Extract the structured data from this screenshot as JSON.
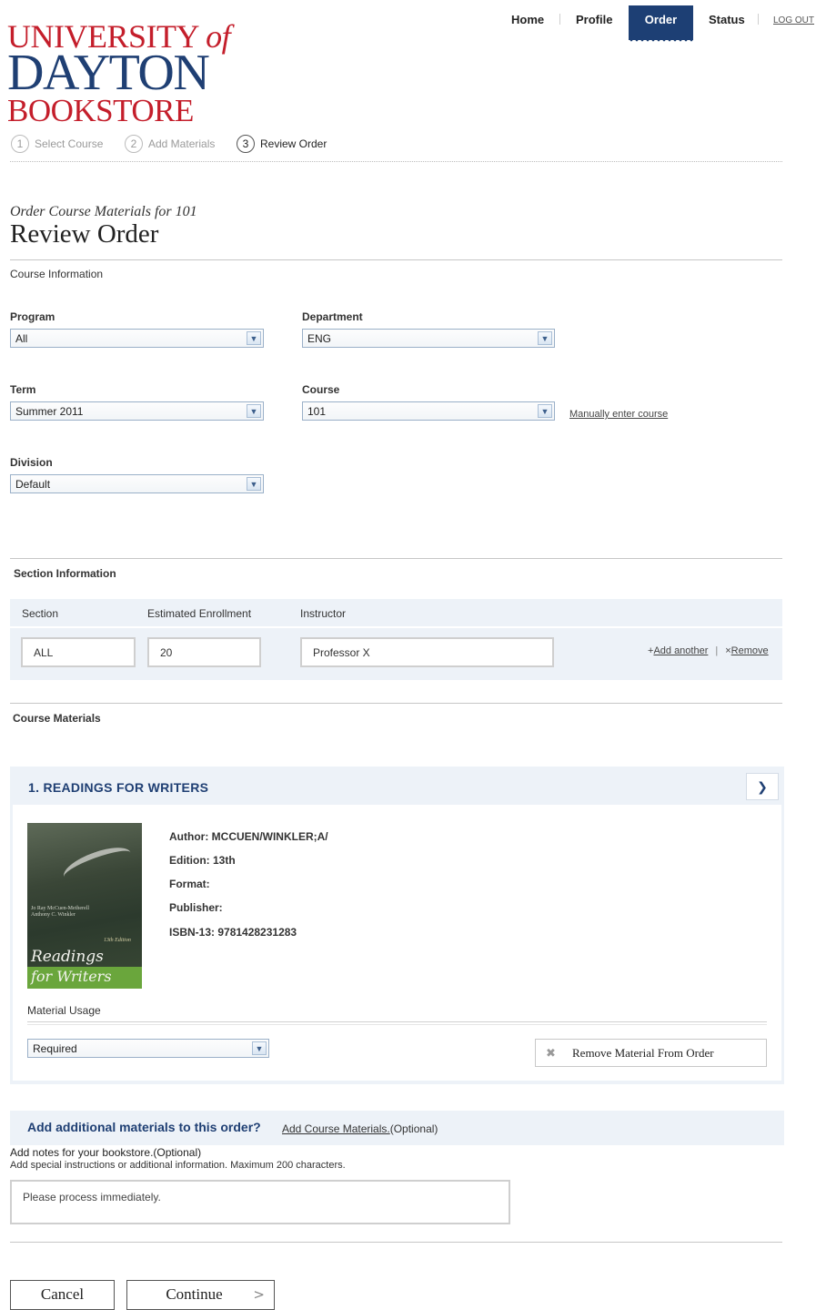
{
  "logo": {
    "line1_main": "UNIVERSITY",
    "line1_of": "of",
    "line2": "DAYTON",
    "line3": "BOOKSTORE"
  },
  "nav": {
    "home": "Home",
    "profile": "Profile",
    "order": "Order",
    "status": "Status",
    "logout": "LOG OUT"
  },
  "steps": [
    {
      "num": "1",
      "label": "Select Course"
    },
    {
      "num": "2",
      "label": "Add Materials"
    },
    {
      "num": "3",
      "label": "Review Order"
    }
  ],
  "page": {
    "subtitle": "Order Course Materials for 101",
    "title": "Review Order"
  },
  "course_info": {
    "heading": "Course Information",
    "program": {
      "label": "Program",
      "value": "All"
    },
    "department": {
      "label": "Department",
      "value": "ENG"
    },
    "term": {
      "label": "Term",
      "value": "Summer 2011"
    },
    "course": {
      "label": "Course",
      "value": "101"
    },
    "manual_link": "Manually enter course",
    "division": {
      "label": "Division",
      "value": "Default"
    }
  },
  "section_info": {
    "heading": "Section Information",
    "col_section": "Section",
    "col_enrollment": "Estimated Enrollment",
    "col_instructor": "Instructor",
    "section_value": "ALL",
    "enrollment_value": "20",
    "instructor_value": "Professor X",
    "add_prefix": "+",
    "add_label": "Add another",
    "sep": "|",
    "remove_prefix": "×",
    "remove_label": "Remove"
  },
  "materials": {
    "heading": "Course Materials",
    "item_title": "1. READINGS FOR WRITERS",
    "cover": {
      "authors": "Jo Ray McCuen-Metherell\nAnthony C. Winkler",
      "edition": "13th Edition",
      "title1": "Readings",
      "title2": "for Writers"
    },
    "author": "Author: MCCUEN/WINKLER;A/",
    "edition": "Edition: 13th",
    "format": "Format:",
    "publisher": "Publisher:",
    "isbn": "ISBN-13: 9781428231283",
    "usage_label": "Material Usage",
    "usage_value": "Required",
    "remove_button": "Remove Material From Order"
  },
  "additional": {
    "question": "Add additional materials to this order?",
    "link": "Add Course Materials.",
    "optional": "(Optional)"
  },
  "notes": {
    "title": "Add notes for your bookstore.(Optional)",
    "subtitle": "Add special instructions or additional information. Maximum 200 characters.",
    "value": "Please process immediately."
  },
  "buttons": {
    "cancel": "Cancel",
    "continue": "Continue"
  }
}
